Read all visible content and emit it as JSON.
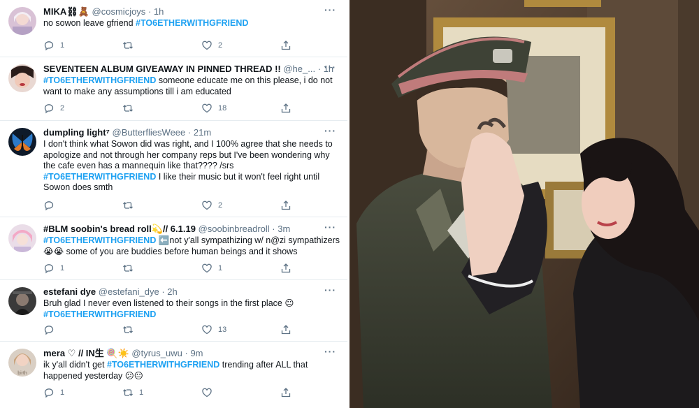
{
  "tweets": [
    {
      "name": "MIKA⛓🧸",
      "handle": "@cosmicjoys",
      "time": "1h",
      "body_pre": "no sowon leave gfriend ",
      "tag": "#TO6ETHERWITHGFRIEND",
      "body_post": "",
      "replies": "1",
      "retweets": "",
      "likes": "2"
    },
    {
      "name": "SEVENTEEN ALBUM GIVEAWAY IN PINNED THREAD !!",
      "handle": "@he_...",
      "time": "1h",
      "body_pre": "",
      "tag": "#TO6ETHERWITHGFRIEND",
      "body_post": " someone educate me on this please, i do not want to make any assumptions till i am educated",
      "replies": "2",
      "retweets": "",
      "likes": "18"
    },
    {
      "name": "dumpling light⁷",
      "handle": "@ButterfliesWeee",
      "time": "21m",
      "body_pre": "I don't think what Sowon did was right, and I 100% agree that she needs to apologize and not through her company reps but I've been wondering why the cafe even has a mannequin like that???? /srs",
      "tag": "#TO6ETHERWITHGFRIEND",
      "body_post": " I like their music but it won't feel right until Sowon does smth",
      "replies": "",
      "retweets": "",
      "likes": "2"
    },
    {
      "name": "#BLM soobin's bread roll💫// 6.1.19",
      "handle": "@soobinbreadroll",
      "time": "3m",
      "body_pre": "",
      "tag": "#TO6ETHERWITHGFRIEND",
      "body_post": " ⬅️not y'all sympathizing w/ n@zi sympathizers 😭😭 some of you are buddies before human beings and it shows",
      "replies": "1",
      "retweets": "",
      "likes": "1"
    },
    {
      "name": "estefani dye",
      "handle": "@estefani_dye",
      "time": "2h",
      "body_pre": "Bruh glad I never even listened to their songs in the first place 😐",
      "tag": "#TO6ETHERWITHGFRIEND",
      "body_post": "",
      "replies": "",
      "retweets": "",
      "likes": "13"
    },
    {
      "name": "mera ♡ // IN生 🍭☀️",
      "handle": "@tyrus_uwu",
      "time": "9m",
      "body_pre": "ik y'all didn't get ",
      "tag": "#TO6ETHERWITHGFRIEND",
      "body_post": " trending after ALL that happened yesterday 😕😐",
      "replies": "1",
      "retweets": "1",
      "likes": ""
    }
  ],
  "avatar_labels": {
    "t6": "birth"
  },
  "colors": {
    "accent": "#1da1f2",
    "muted": "#5b7083",
    "divider": "#e6ecf0"
  },
  "icons": [
    "reply-icon",
    "retweet-icon",
    "like-icon",
    "share-icon",
    "more-icon"
  ]
}
